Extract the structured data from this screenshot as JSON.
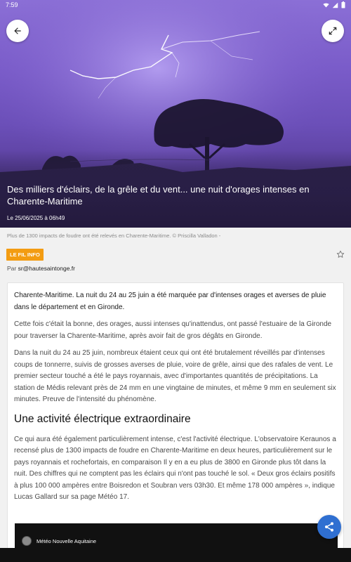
{
  "status_bar": {
    "time": "7:59"
  },
  "hero": {
    "title": "Des milliers d'éclairs, de la grêle et du vent... une nuit d'orages intenses en Charente-Maritime",
    "date": "Le 25/06/2025 à 06h49"
  },
  "caption": "Plus de 1300 impacts de foudre ont été relevés en Charente-Maritime. © Priscilla Valladon -",
  "tag": "LE FIL INFO",
  "author": {
    "prefix": "Par ",
    "name": "sr@hautesaintonge.fr"
  },
  "article": {
    "lead": "Charente-Maritime. La nuit du 24 au 25 juin a été marquée par d'intenses orages et averses de pluie dans le département et en Gironde.",
    "p1": "Cette fois c'était la bonne, des orages, aussi intenses qu'inattendus, ont passé l'estuaire de la Gironde pour traverser la Charente-Maritime, après avoir fait de gros dégâts en Gironde.",
    "p2": "Dans la nuit du 24 au 25 juin, nombreux étaient ceux qui ont été brutalement réveillés par d'intenses coups de tonnerre, suivis de grosses averses de pluie, voire de grêle, ainsi que des rafales de vent. Le premier secteur touché a été le pays royannais, avec d'importantes quantités de précipitations. La station de Médis relevant près de 24 mm en une vingtaine de minutes, et même 9 mm en seulement six minutes. Preuve de l'intensité du phénomène.",
    "subheading": "Une activité électrique extraordinaire",
    "p3": "Ce qui aura été également particulièrement intense, c'est l'activité électrique. L'observatoire Keraunos a recensé plus de 1300 impacts de foudre en Charente-Maritime en deux heures, particulièrement sur le pays royannais et rochefortais, en comparaison Il y en a eu plus de 3800 en Gironde plus tôt dans la nuit. Des chiffres qui ne comptent pas les éclairs qui n'ont pas touché le sol. « Deux gros éclairs positifs à plus 100 000 ampères entre Boisredon et Soubran vers 03h30. Et même 178 000 ampères », indique Lucas Gallard sur sa page Météo 17."
  },
  "video": {
    "channel": "Météo Nouvelle Aquitaine"
  },
  "icons": {
    "back": "arrow-left-icon",
    "expand": "expand-icon",
    "star": "star-outline-icon",
    "share": "share-icon"
  },
  "colors": {
    "accent": "#f39c12",
    "fab": "#2f6fd1"
  }
}
